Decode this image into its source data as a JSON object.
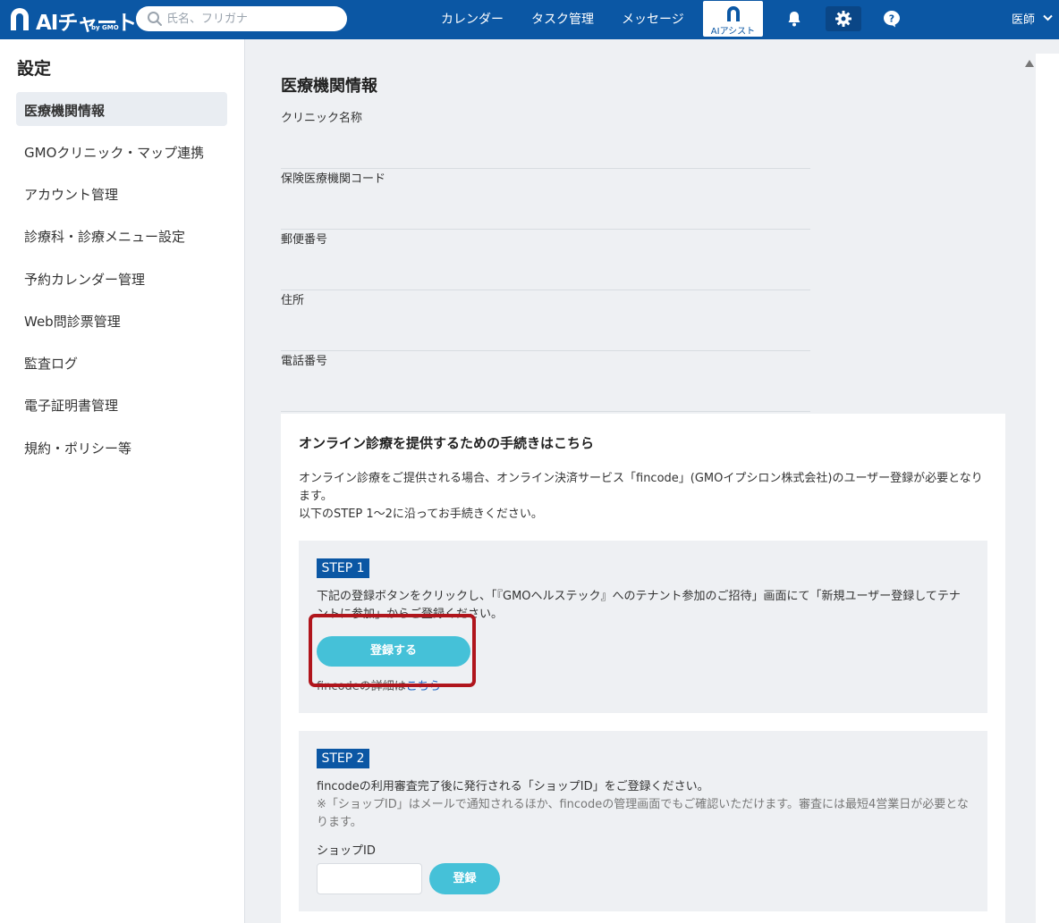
{
  "header": {
    "logo_text": "AIチャート",
    "logo_sub": "by GMO",
    "search_placeholder": "氏名、フリガナ",
    "nav": [
      "カレンダー",
      "タスク管理",
      "メッセージ"
    ],
    "ai_assist_label": "AIアシスト",
    "user_label": "医師"
  },
  "sidebar": {
    "title": "設定",
    "items": [
      {
        "label": "医療機関情報"
      },
      {
        "label": "GMOクリニック・マップ連携"
      },
      {
        "label": "アカウント管理"
      },
      {
        "label": "診療科・診療メニュー設定"
      },
      {
        "label": "予約カレンダー管理"
      },
      {
        "label": "Web問診票管理"
      },
      {
        "label": "監査ログ"
      },
      {
        "label": "電子証明書管理"
      },
      {
        "label": "規約・ポリシー等"
      }
    ]
  },
  "main": {
    "title": "医療機関情報",
    "fields": [
      {
        "label": "クリニック名称"
      },
      {
        "label": "保険医療機関コード"
      },
      {
        "label": "郵便番号"
      },
      {
        "label": "住所"
      },
      {
        "label": "電話番号"
      }
    ]
  },
  "online": {
    "title": "オンライン診療を提供するための手続きはこちら",
    "desc_line1": "オンライン診療をご提供される場合、オンライン決済サービス「fincode」(GMOイプシロン株式会社)のユーザー登録が必要となります。",
    "desc_line2": "以下のSTEP 1〜2に沿ってお手続きください。",
    "step1": {
      "badge": "STEP 1",
      "text": "下記の登録ボタンをクリックし、「『GMOヘルステック』へのテナント参加のご招待」画面にて「新規ユーザー登録してテナントに参加」からご登録ください。",
      "button": "登録する",
      "link_prefix": "fincodeの詳細は",
      "link_text": "こちら"
    },
    "step2": {
      "badge": "STEP 2",
      "text": "fincodeの利用審査完了後に発行される「ショップID」をご登録ください。",
      "note": "※「ショップID」はメールで通知されるほか、fincodeの管理画面でもご確認いただけます。審査には最短4営業日が必要となります。",
      "shop_label": "ショップID",
      "shop_value": "",
      "button": "登録"
    }
  },
  "colors": {
    "header_bg": "#0b57a4",
    "accent_button": "#45c1d8",
    "highlight": "#b0151c"
  }
}
